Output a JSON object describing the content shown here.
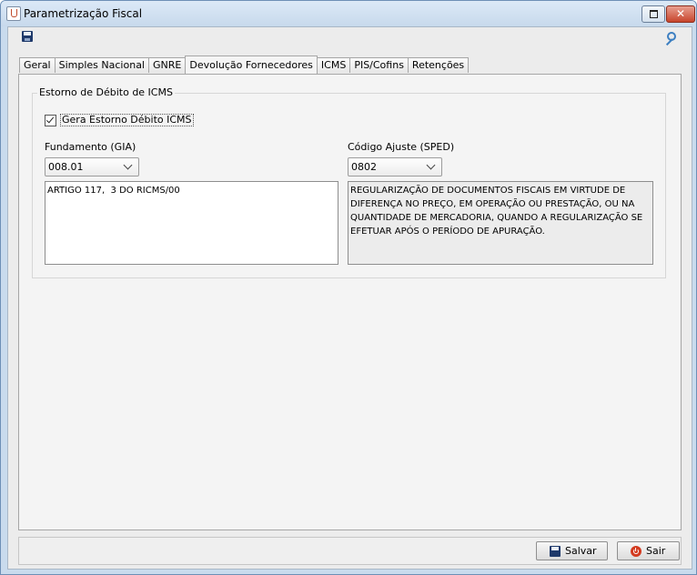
{
  "window": {
    "title": "Parametrização Fiscal"
  },
  "tabs": [
    {
      "label": "Geral",
      "active": false
    },
    {
      "label": "Simples Nacional",
      "active": false
    },
    {
      "label": "GNRE",
      "active": false
    },
    {
      "label": "Devolução Fornecedores",
      "active": true
    },
    {
      "label": "ICMS",
      "active": false
    },
    {
      "label": "PIS/Cofins",
      "active": false
    },
    {
      "label": "Retenções",
      "active": false
    }
  ],
  "estorno": {
    "group_title": "Estorno de Débito de ICMS",
    "checkbox_label": "Gera Estorno Débito ICMS",
    "checked": true,
    "fundamento_label": "Fundamento (GIA)",
    "fundamento_value": "008.01",
    "fundamento_text": "ARTIGO 117,  3 DO RICMS/00",
    "codigo_label": "Código Ajuste (SPED)",
    "codigo_value": "0802",
    "codigo_text": "REGULARIZAÇÃO DE DOCUMENTOS FISCAIS EM VIRTUDE DE DIFERENÇA NO PREÇO, EM OPERAÇÃO OU PRESTAÇÃO, OU NA QUANTIDADE DE MERCADORIA, QUANDO A REGULARIZAÇÃO SE EFETUAR APÓS O PERÍODO DE APURAÇÃO."
  },
  "footer": {
    "save_label": "Salvar",
    "exit_label": "Sair"
  },
  "icons": {
    "toolbar": [
      "save-icon",
      "key-icon"
    ],
    "buttons": [
      "save-icon",
      "power-icon"
    ]
  }
}
